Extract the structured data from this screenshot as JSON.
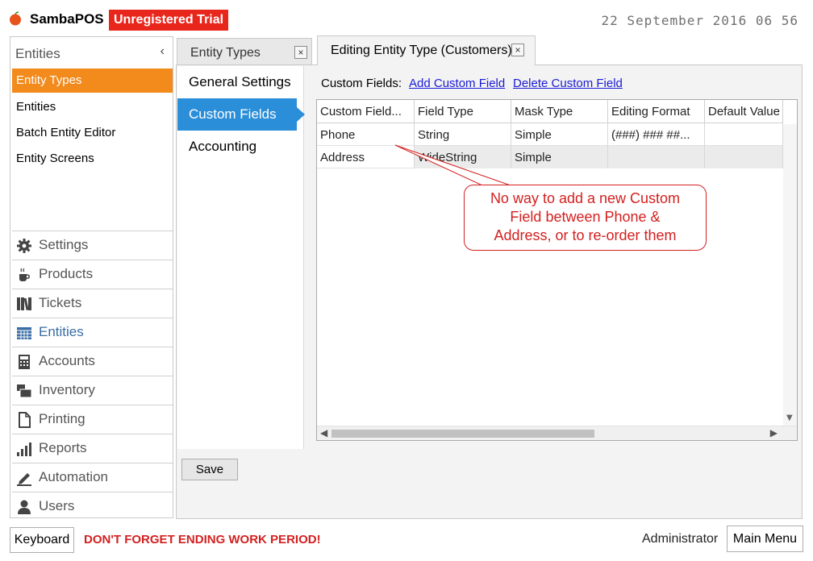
{
  "header": {
    "app_name": "SambaPOS",
    "trial_badge": "Unregistered Trial",
    "datetime": "22 September 2016 06 56"
  },
  "sidebar": {
    "section_title": "Entities",
    "collapse_glyph": "‹",
    "sub_items": [
      {
        "label": "Entity Types",
        "active": true
      },
      {
        "label": "Entities",
        "active": false
      },
      {
        "label": "Batch Entity Editor",
        "active": false
      },
      {
        "label": "Entity Screens",
        "active": false
      }
    ],
    "nav_items": [
      {
        "label": "Settings",
        "icon": "gear-icon"
      },
      {
        "label": "Products",
        "icon": "coffee-cup-icon"
      },
      {
        "label": "Tickets",
        "icon": "books-icon"
      },
      {
        "label": "Entities",
        "icon": "table-icon",
        "active": true
      },
      {
        "label": "Accounts",
        "icon": "calculator-icon"
      },
      {
        "label": "Inventory",
        "icon": "inventory-icon"
      },
      {
        "label": "Printing",
        "icon": "document-icon"
      },
      {
        "label": "Reports",
        "icon": "bar-chart-icon"
      },
      {
        "label": "Automation",
        "icon": "pen-icon"
      },
      {
        "label": "Users",
        "icon": "user-icon"
      }
    ]
  },
  "tabs": [
    {
      "label": "Entity Types",
      "close": "×"
    },
    {
      "label": "Editing Entity Type (Customers)",
      "close": "×"
    }
  ],
  "inner_nav": [
    {
      "label": "General Settings",
      "active": false
    },
    {
      "label": "Custom Fields",
      "active": true
    },
    {
      "label": "Accounting",
      "active": false
    }
  ],
  "custom_fields": {
    "label": "Custom Fields:",
    "add_link": "Add Custom Field",
    "delete_link": "Delete Custom Field",
    "columns": [
      "Custom Field...",
      "Field Type",
      "Mask Type",
      "Editing Format",
      "Default Value"
    ],
    "rows": [
      [
        "Phone",
        "String",
        "Simple",
        "(###) ### ##...",
        ""
      ],
      [
        "Address",
        "WideString",
        "Simple",
        "",
        ""
      ]
    ]
  },
  "annotation": {
    "line1": "No way to add a new Custom",
    "line2": "Field between Phone &",
    "line3": "Address, or to re-order them",
    "color": "#d42020"
  },
  "save_label": "Save",
  "footer": {
    "keyboard_label": "Keyboard",
    "warning": "DON'T FORGET ENDING WORK PERIOD!",
    "user": "Administrator",
    "main_menu_label": "Main Menu"
  },
  "colors": {
    "accent_orange": "#f28a1c",
    "accent_blue": "#2b8ed8",
    "badge_red": "#e8261c"
  }
}
